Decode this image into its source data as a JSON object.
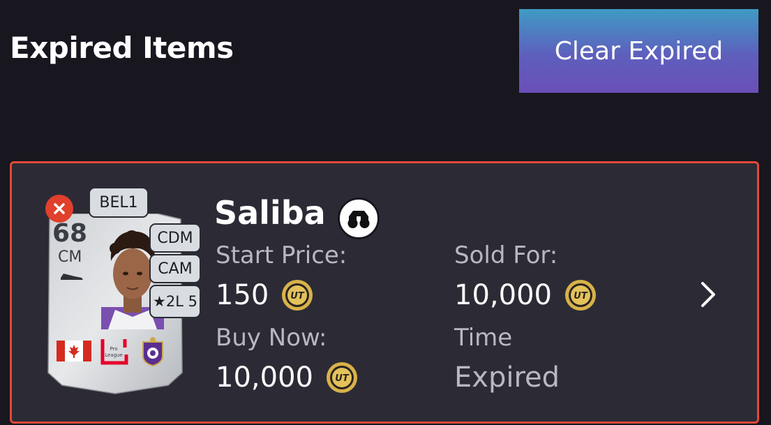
{
  "header": {
    "title": "Expired Items",
    "clear_button_label": "Clear Expired"
  },
  "item": {
    "player_name": "Saliba",
    "card": {
      "rating": "68",
      "position": "CM",
      "league_chip": "BEL1",
      "alt_positions": [
        "CDM",
        "CAM"
      ],
      "skill_chip": "★2L 5",
      "league_logo_text": "Pro League"
    },
    "start_price_label": "Start Price:",
    "start_price_value": "150",
    "buy_now_label": "Buy Now:",
    "buy_now_value": "10,000",
    "sold_for_label": "Sold For:",
    "sold_for_value": "10,000",
    "time_label": "Time",
    "time_value": "Expired",
    "coin_text": "UT"
  },
  "colors": {
    "background": "#18161f",
    "card_background": "#2c2b35",
    "selection_border": "#e34a35",
    "coin_gold": "#d8b24a",
    "button_gradient_top": "#3f9bc4",
    "button_gradient_bottom": "#6a4fb8"
  },
  "icons": {
    "remove": "close-icon",
    "scout": "binoculars-icon",
    "currency": "coin-icon",
    "navigate": "chevron-right-icon"
  }
}
